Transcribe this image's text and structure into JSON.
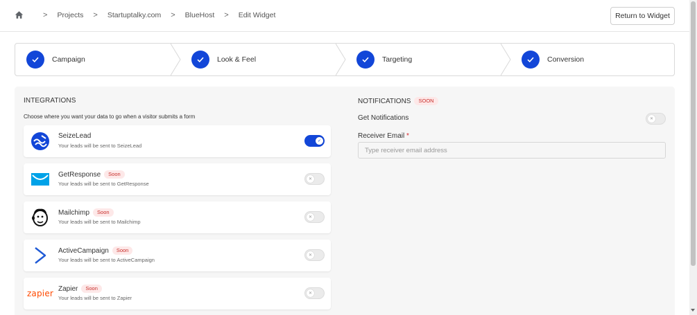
{
  "breadcrumb": {
    "items": [
      "Projects",
      "Startuptalky.com",
      "BlueHost",
      "Edit Widget"
    ],
    "separator": ">"
  },
  "header": {
    "return_button": "Return to Widget"
  },
  "steps": [
    {
      "label": "Campaign",
      "completed": true
    },
    {
      "label": "Look & Feel",
      "completed": true
    },
    {
      "label": "Targeting",
      "completed": true
    },
    {
      "label": "Conversion",
      "completed": true
    }
  ],
  "integrations": {
    "title": "INTEGRATIONS",
    "subtitle": "Choose where you want your data to go when a visitor submits a form",
    "items": [
      {
        "name": "SeizeLead",
        "soon": "",
        "desc": "Your leads will be sent to SeizeLead",
        "enabled": true,
        "icon": "seizelead-logo"
      },
      {
        "name": "GetResponse",
        "soon": "Soon",
        "desc": "Your leads will be sent to GetResponse",
        "enabled": false,
        "icon": "getresponse-logo"
      },
      {
        "name": "Mailchimp",
        "soon": "Soon",
        "desc": "Your leads will be sent to Mailchimp",
        "enabled": false,
        "icon": "mailchimp-logo"
      },
      {
        "name": "ActiveCampaign",
        "soon": "Soon",
        "desc": "Your leads will be sent to ActiveCampaign",
        "enabled": false,
        "icon": "activecampaign-logo"
      },
      {
        "name": "Zapier",
        "soon": "Soon",
        "desc": "Your leads will be sent to Zapier",
        "enabled": false,
        "icon": "zapier-logo",
        "logo_text": "zapier"
      }
    ]
  },
  "notifications": {
    "title": "NOTIFICATIONS",
    "soon": "SOON",
    "get_label": "Get Notifications",
    "get_enabled": false,
    "email_label": "Receiver Email",
    "email_required_mark": "*",
    "email_placeholder": "Type receiver email address",
    "email_value": ""
  },
  "colors": {
    "primary": "#1246d8",
    "soon_bg": "#fde8e8",
    "soon_text": "#c9302c",
    "zapier": "#ff4a00",
    "getresponse": "#00a2e8"
  }
}
